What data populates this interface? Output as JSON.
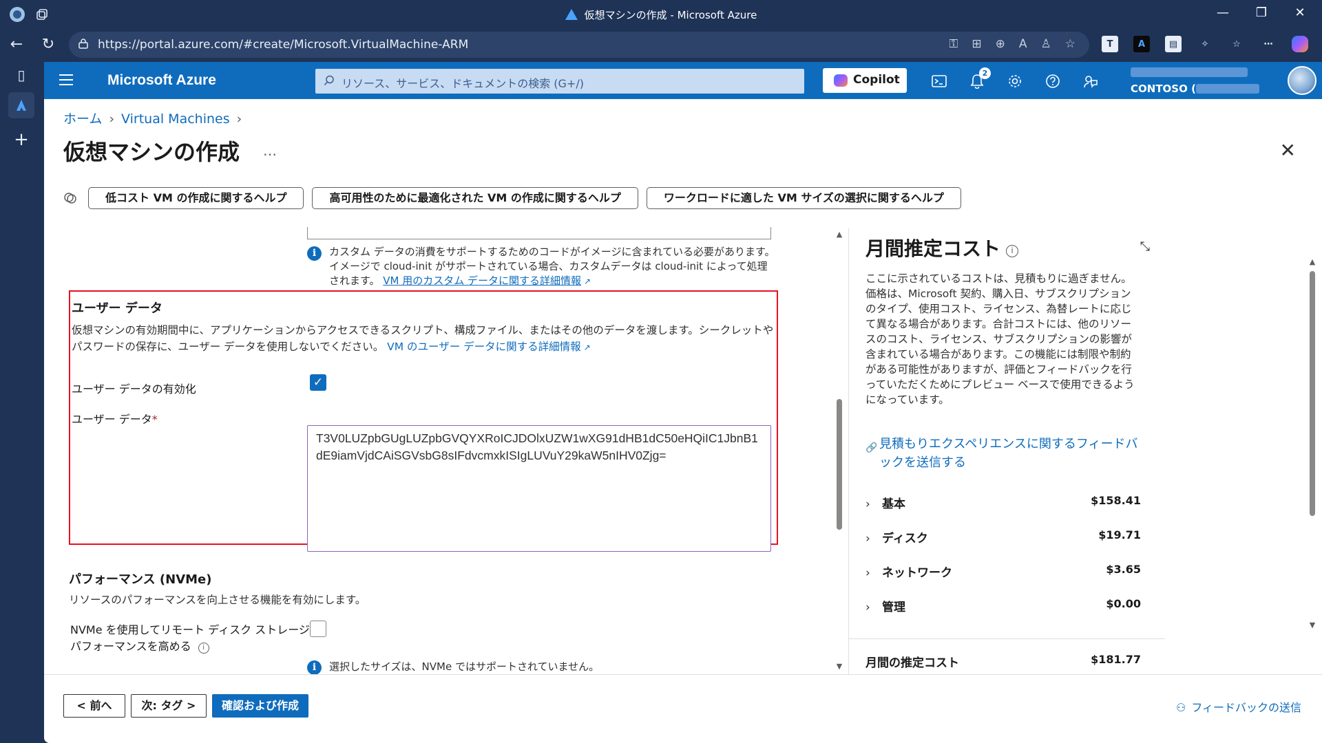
{
  "window": {
    "title": "仮想マシンの作成 - Microsoft Azure"
  },
  "browser": {
    "url": "https://portal.azure.com/#create/Microsoft.VirtualMachine-ARM"
  },
  "azure": {
    "brand": "Microsoft Azure",
    "search_placeholder": "リソース、サービス、ドキュメントの検索 (G+/)",
    "copilot_label": "Copilot",
    "notification_count": "2",
    "tenant": "CONTOSO ("
  },
  "breadcrumb": {
    "home": "ホーム",
    "vms": "Virtual Machines"
  },
  "page": {
    "title": "仮想マシンの作成",
    "more": "…"
  },
  "help_buttons": [
    "低コスト VM の作成に関するヘルプ",
    "高可用性のために最適化された VM の作成に関するヘルプ",
    "ワークロードに適した VM サイズの選択に関するヘルプ"
  ],
  "custom_data_info": {
    "text": "カスタム データの消費をサポートするためのコードがイメージに含まれている必要があります。イメージで cloud-init がサポートされている場合、カスタムデータは cloud-init によって処理されます。",
    "link": "VM 用のカスタム データに関する詳細情報"
  },
  "user_data": {
    "heading": "ユーザー データ",
    "description": "仮想マシンの有効期間中に、アプリケーションからアクセスできるスクリプト、構成ファイル、またはその他のデータを渡します。シークレットやパスワードの保存に、ユーザー データを使用しないでください。",
    "link": "VM のユーザー データに関する詳細情報",
    "enable_label": "ユーザー データの有効化",
    "enable_checked": true,
    "field_label": "ユーザー データ",
    "required_mark": "*",
    "value": "T3V0LUZpbGUgLUZpbGVQYXRoICJDOlxUZW1wXG91dHB1dC50eHQiIC1JbnB1dE9iamVjdCAiSGVsbG8sIFdvcmxkISIgLUVuY29kaW5nIHV0Zjg="
  },
  "performance": {
    "heading": "パフォーマンス (NVMe)",
    "description": "リソースのパフォーマンスを向上させる機能を有効にします。",
    "nvme_label_line1": "NVMe を使用してリモート ディスク ストレージ",
    "nvme_label_line2": "パフォーマンスを高める",
    "nvme_checked": false,
    "info_cut": "選択したサイズは、NVMe ではサポートされていません。"
  },
  "cost_panel": {
    "title": "月間推定コスト",
    "description": "ここに示されているコストは、見積もりに過ぎません。価格は、Microsoft 契約、購入日、サブスクリプションのタイプ、使用コスト、ライセンス、為替レートに応じて異なる場合があります。合計コストには、他のリソースのコスト、ライセンス、サブスクリプションの影響が含まれている場合があります。この機能には制限や制約がある可能性がありますが、評価とフィードバックを行っていただくためにプレビュー ベースで使用できるようになっています。",
    "feedback_link": "見積もりエクスペリエンスに関するフィードバックを送信する",
    "rows": [
      {
        "label": "基本",
        "amount": "$158.41"
      },
      {
        "label": "ディスク",
        "amount": "$19.71"
      },
      {
        "label": "ネットワーク",
        "amount": "$3.65"
      },
      {
        "label": "管理",
        "amount": "$0.00"
      }
    ],
    "total_label": "月間の推定コスト",
    "total_amount": "$181.77"
  },
  "footer": {
    "prev": "< 前へ",
    "next": "次: タグ >",
    "review": "確認および作成",
    "send_feedback": "フィードバックの送信"
  }
}
